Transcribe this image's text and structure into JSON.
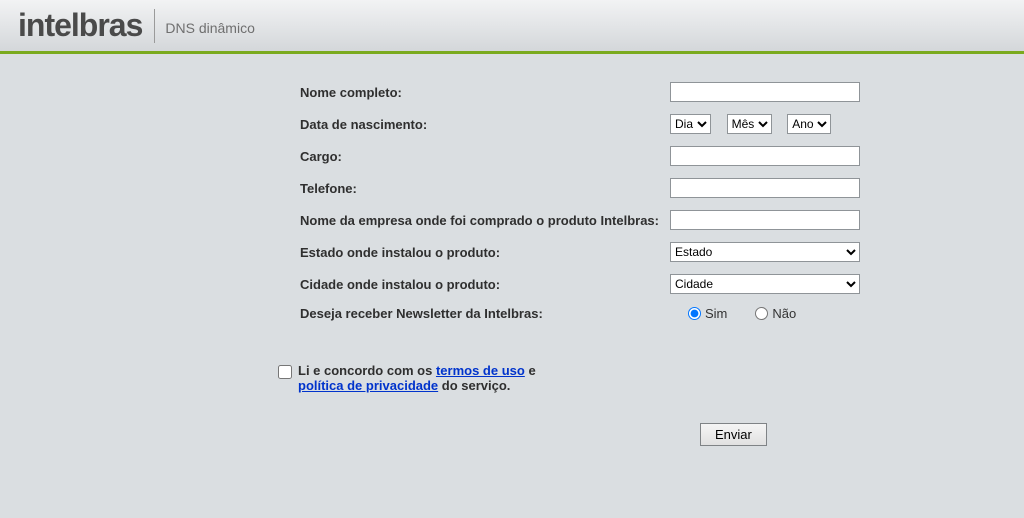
{
  "header": {
    "brand": "intelbras",
    "subtitle": "DNS dinâmico"
  },
  "form": {
    "nome_label": "Nome completo:",
    "data_label": "Data de nascimento:",
    "dia": "Dia",
    "mes": "Mês",
    "ano": "Ano",
    "cargo_label": "Cargo:",
    "telefone_label": "Telefone:",
    "empresa_label": "Nome da empresa onde foi comprado o produto Intelbras:",
    "estado_label": "Estado onde instalou o produto:",
    "estado_value": "Estado",
    "cidade_label": "Cidade onde instalou o produto:",
    "cidade_value": "Cidade",
    "newsletter_label": "Deseja receber Newsletter da Intelbras:",
    "sim": "Sim",
    "nao": "Não"
  },
  "terms": {
    "prefix": "Li e concordo com os ",
    "termos": "termos de uso",
    "middle": " e ",
    "politica": "política de privacidade",
    "suffix": " do serviço."
  },
  "submit_label": "Enviar"
}
